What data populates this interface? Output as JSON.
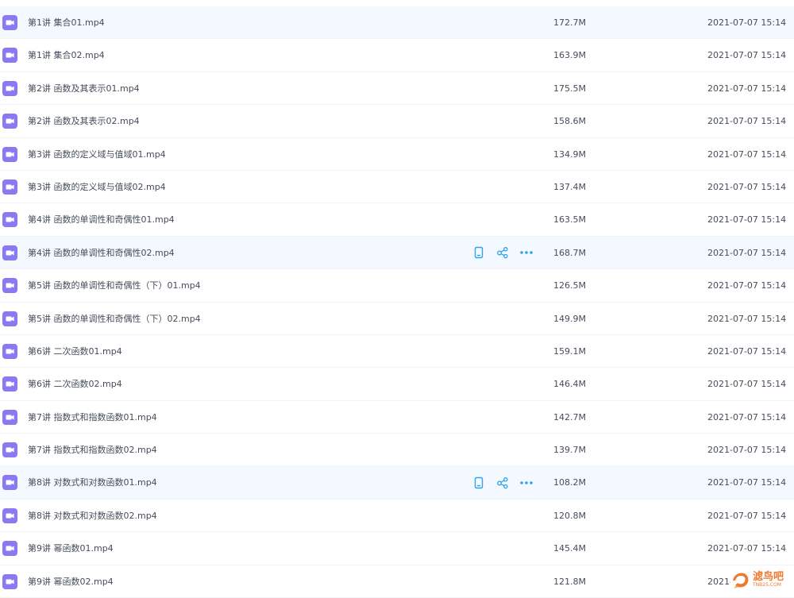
{
  "files": [
    {
      "name": "第1讲 集合01.mp4",
      "size": "172.7M",
      "date": "2021-07-07 15:14",
      "highlighted": true,
      "show_actions": false
    },
    {
      "name": "第1讲 集合02.mp4",
      "size": "163.9M",
      "date": "2021-07-07 15:14",
      "highlighted": false,
      "show_actions": false
    },
    {
      "name": "第2讲 函数及其表示01.mp4",
      "size": "175.5M",
      "date": "2021-07-07 15:14",
      "highlighted": false,
      "show_actions": false
    },
    {
      "name": "第2讲 函数及其表示02.mp4",
      "size": "158.6M",
      "date": "2021-07-07 15:14",
      "highlighted": false,
      "show_actions": false
    },
    {
      "name": "第3讲 函数的定义域与值域01.mp4",
      "size": "134.9M",
      "date": "2021-07-07 15:14",
      "highlighted": false,
      "show_actions": false
    },
    {
      "name": "第3讲 函数的定义域与值域02.mp4",
      "size": "137.4M",
      "date": "2021-07-07 15:14",
      "highlighted": false,
      "show_actions": false
    },
    {
      "name": "第4讲 函数的单调性和奇偶性01.mp4",
      "size": "163.5M",
      "date": "2021-07-07 15:14",
      "highlighted": false,
      "show_actions": false
    },
    {
      "name": "第4讲 函数的单调性和奇偶性02.mp4",
      "size": "168.7M",
      "date": "2021-07-07 15:14",
      "highlighted": true,
      "show_actions": true
    },
    {
      "name": "第5讲 函数的单调性和奇偶性（下）01.mp4",
      "size": "126.5M",
      "date": "2021-07-07 15:14",
      "highlighted": false,
      "show_actions": false
    },
    {
      "name": "第5讲 函数的单调性和奇偶性（下）02.mp4",
      "size": "149.9M",
      "date": "2021-07-07 15:14",
      "highlighted": false,
      "show_actions": false
    },
    {
      "name": "第6讲 二次函数01.mp4",
      "size": "159.1M",
      "date": "2021-07-07 15:14",
      "highlighted": false,
      "show_actions": false
    },
    {
      "name": "第6讲 二次函数02.mp4",
      "size": "146.4M",
      "date": "2021-07-07 15:14",
      "highlighted": false,
      "show_actions": false
    },
    {
      "name": "第7讲 指数式和指数函数01.mp4",
      "size": "142.7M",
      "date": "2021-07-07 15:14",
      "highlighted": false,
      "show_actions": false
    },
    {
      "name": "第7讲 指数式和指数函数02.mp4",
      "size": "139.7M",
      "date": "2021-07-07 15:14",
      "highlighted": false,
      "show_actions": false
    },
    {
      "name": "第8讲 对数式和对数函数01.mp4",
      "size": "108.2M",
      "date": "2021-07-07 15:14",
      "highlighted": true,
      "show_actions": true
    },
    {
      "name": "第8讲 对数式和对数函数02.mp4",
      "size": "120.8M",
      "date": "2021-07-07 15:14",
      "highlighted": false,
      "show_actions": false
    },
    {
      "name": "第9讲 幂函数01.mp4",
      "size": "145.4M",
      "date": "2021-07-07 15:14",
      "highlighted": false,
      "show_actions": false
    },
    {
      "name": "第9讲 幂函数02.mp4",
      "size": "121.8M",
      "date": "2021-0",
      "highlighted": false,
      "show_actions": false
    }
  ],
  "icons": {
    "file_icon": "video-file-icon",
    "actions": [
      "phone-icon",
      "share-icon",
      "more-icon"
    ]
  },
  "colors": {
    "file_icon_bg": "#8a7af2",
    "action_icon": "#2ea3e8",
    "highlight_row": "#f3f9fe",
    "text": "#454d5a",
    "watermark": "#f07830"
  },
  "watermark": {
    "text": "滤鸟吧",
    "subtext": "TNB25.COM"
  }
}
